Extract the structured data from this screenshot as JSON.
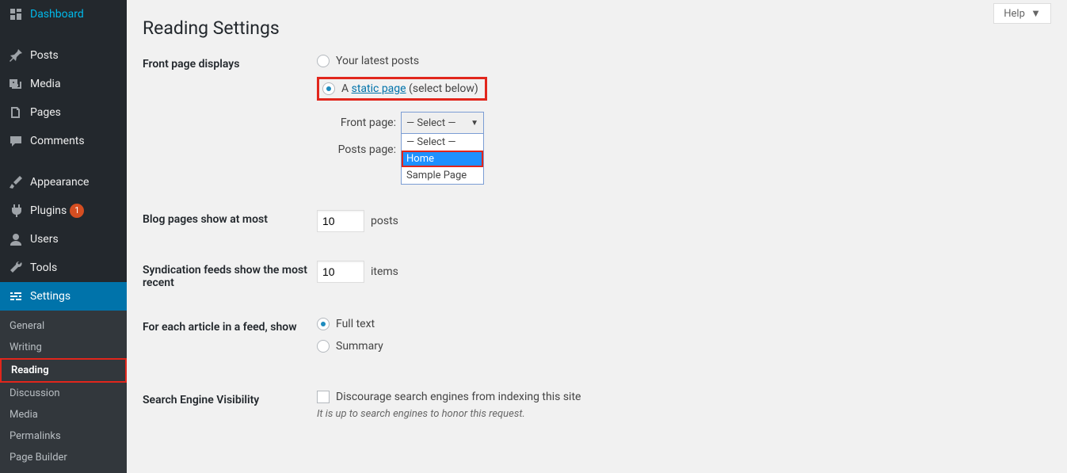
{
  "sidebar": {
    "items": [
      {
        "label": "Dashboard"
      },
      {
        "label": "Posts"
      },
      {
        "label": "Media"
      },
      {
        "label": "Pages"
      },
      {
        "label": "Comments"
      },
      {
        "label": "Appearance"
      },
      {
        "label": "Plugins",
        "badge": "1"
      },
      {
        "label": "Users"
      },
      {
        "label": "Tools"
      },
      {
        "label": "Settings"
      }
    ],
    "submenu": [
      {
        "label": "General"
      },
      {
        "label": "Writing"
      },
      {
        "label": "Reading"
      },
      {
        "label": "Discussion"
      },
      {
        "label": "Media"
      },
      {
        "label": "Permalinks"
      },
      {
        "label": "Page Builder"
      }
    ]
  },
  "header": {
    "help": "Help",
    "title": "Reading Settings"
  },
  "form": {
    "front_displays": {
      "label": "Front page displays",
      "opt1": "Your latest posts",
      "opt2_a": "A ",
      "opt2_link": "static page",
      "opt2_b": " (select below)",
      "front_page_label": "Front page:",
      "posts_page_label": "Posts page:",
      "select_placeholder": "— Select —",
      "options": [
        "— Select —",
        "Home",
        "Sample Page"
      ]
    },
    "blog_pages": {
      "label": "Blog pages show at most",
      "value": "10",
      "suffix": "posts"
    },
    "syndication": {
      "label": "Syndication feeds show the most recent",
      "value": "10",
      "suffix": "items"
    },
    "feed_article": {
      "label": "For each article in a feed, show",
      "opt1": "Full text",
      "opt2": "Summary"
    },
    "seo": {
      "label": "Search Engine Visibility",
      "checkbox": "Discourage search engines from indexing this site",
      "note": "It is up to search engines to honor this request."
    }
  }
}
